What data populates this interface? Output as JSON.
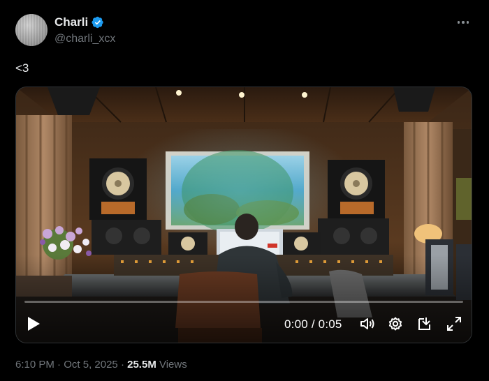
{
  "author": {
    "name": "Charli",
    "handle": "@charli_xcx",
    "verified": true
  },
  "tweet": {
    "text": "<3"
  },
  "video": {
    "current_time": "0:00",
    "separator": " / ",
    "duration": "0:05",
    "progress": 0.0
  },
  "meta": {
    "time": "6:10 PM",
    "dot1": " · ",
    "date": "Oct 5, 2025",
    "dot2": " · ",
    "views_count": "25.5M",
    "views_label": " Views"
  },
  "colors": {
    "verified_blue": "#1d9bf0",
    "secondary_text": "#71767b",
    "primary_text": "#e7e9ea"
  }
}
